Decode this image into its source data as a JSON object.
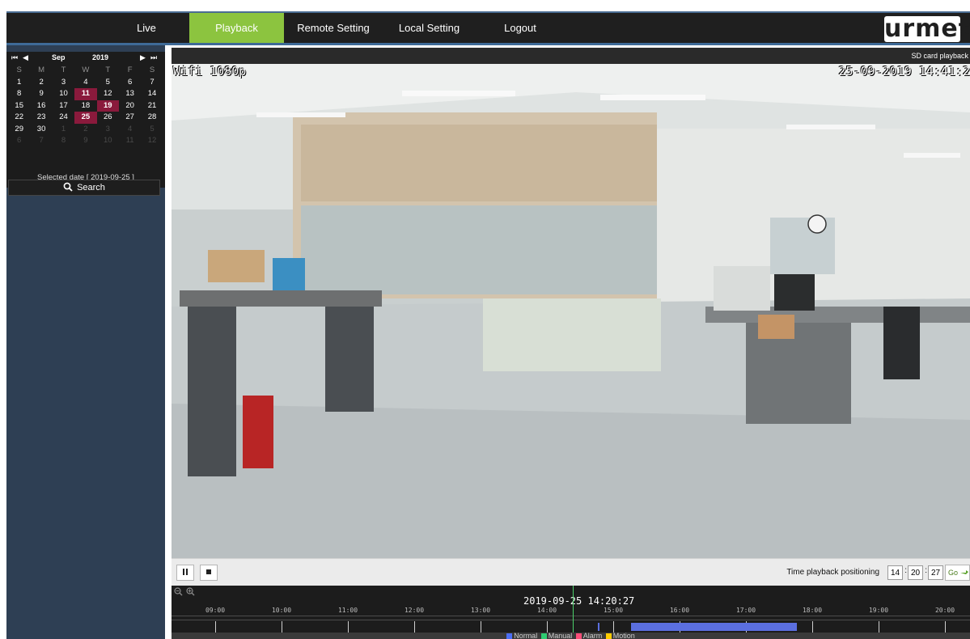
{
  "nav": {
    "items": [
      "Live",
      "Playback",
      "Remote Setting",
      "Local Setting",
      "Logout"
    ],
    "active": "Playback",
    "logo": "urmet"
  },
  "calendar": {
    "nav_prev_year": "⏮",
    "nav_prev_month": "◀",
    "month": "Sep",
    "year": "2019",
    "nav_next_month": "▶",
    "nav_next_year": "⏭",
    "weekdays": [
      "S",
      "M",
      "T",
      "W",
      "T",
      "F",
      "S"
    ],
    "rows": [
      [
        "1",
        "2",
        "3",
        "4",
        "5",
        "6",
        "7"
      ],
      [
        "8",
        "9",
        "10",
        "11",
        "12",
        "13",
        "14"
      ],
      [
        "15",
        "16",
        "17",
        "18",
        "19",
        "20",
        "21"
      ],
      [
        "22",
        "23",
        "24",
        "25",
        "26",
        "27",
        "28"
      ],
      [
        "29",
        "30",
        "1",
        "2",
        "3",
        "4",
        "5"
      ],
      [
        "6",
        "7",
        "8",
        "9",
        "10",
        "11",
        "12"
      ]
    ],
    "recorded_days": [
      "11",
      "19",
      "25"
    ],
    "selected_label": "Selected date [ 2019-09-25 ]",
    "search_label": "Search"
  },
  "video": {
    "status": "SD card playback",
    "channel_osd": "Wifi 1080p",
    "datetime_osd": "25-09-2019 14:41:2"
  },
  "controls": {
    "positioning_label": "Time playback positioning",
    "hour": "14",
    "minute": "20",
    "second": "27",
    "go_label": "Go"
  },
  "timeline": {
    "current_time": "2019-09-25 14:20:27",
    "hours": [
      "09:00",
      "10:00",
      "11:00",
      "12:00",
      "13:00",
      "14:00",
      "15:00",
      "16:00",
      "17:00",
      "18:00",
      "19:00",
      "20:00"
    ],
    "legend": [
      {
        "label": "Normal",
        "color": "#4c6ef5"
      },
      {
        "label": "Manual",
        "color": "#2ecc71"
      },
      {
        "label": "Alarm",
        "color": "#ff4f7a"
      },
      {
        "label": "Motion",
        "color": "#ffcc00"
      }
    ]
  },
  "colors": {
    "active_tab": "#8cc43f",
    "recorded_day": "#8a1a3c",
    "normal_recording": "#5b6fe0"
  }
}
